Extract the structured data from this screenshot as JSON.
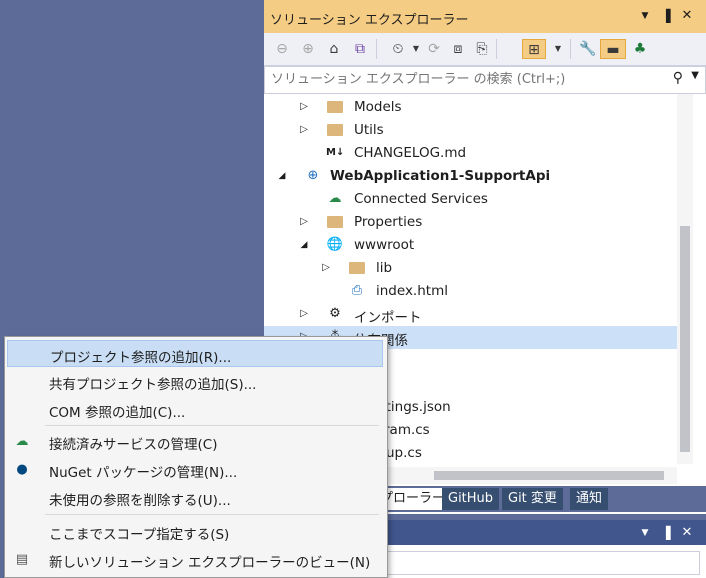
{
  "solution_explorer": {
    "title": "ソリューション エクスプローラー",
    "title_buttons": {
      "dropdown": "▼",
      "pin": "📌",
      "close": "✕"
    },
    "search_placeholder": "ソリューション エクスプローラー の検索 (Ctrl+;)",
    "tree": [
      {
        "label": "Models",
        "icon": "folder-icon",
        "arrow": "▷"
      },
      {
        "label": "Utils",
        "icon": "folder-icon",
        "arrow": "▷"
      },
      {
        "label": "CHANGELOG.md",
        "icon": "markdown-icon",
        "arrow": ""
      },
      {
        "label": "WebApplication1-SupportApi",
        "icon": "web-project-icon",
        "arrow": "◢"
      },
      {
        "label": "Connected Services",
        "icon": "connected-services-icon",
        "arrow": ""
      },
      {
        "label": "Properties",
        "icon": "properties-icon",
        "arrow": "▷"
      },
      {
        "label": "wwwroot",
        "icon": "globe-icon",
        "arrow": "◢"
      },
      {
        "label": "lib",
        "icon": "folder-icon",
        "arrow": "▷"
      },
      {
        "label": "index.html",
        "icon": "html-file-icon",
        "arrow": ""
      },
      {
        "label": "インポート",
        "icon": "imports-icon",
        "arrow": "▷"
      },
      {
        "label": "依存関係",
        "icon": "dependencies-icon",
        "arrow": "▷"
      },
      {
        "label": "ettings.json",
        "icon": "json-file-icon",
        "arrow": ""
      },
      {
        "label": "ram.cs",
        "icon": "cs-file-icon",
        "arrow": ""
      },
      {
        "label": "up.cs",
        "icon": "cs-file-icon",
        "arrow": ""
      }
    ]
  },
  "tabs": [
    {
      "label": "プローラー"
    },
    {
      "label": "GitHub"
    },
    {
      "label": "Git 変更"
    },
    {
      "label": "通知"
    }
  ],
  "context_menu": {
    "items": [
      {
        "label": "プロジェクト参照の追加(R)...",
        "icon": ""
      },
      {
        "label": "共有プロジェクト参照の追加(S)...",
        "icon": ""
      },
      {
        "label": "COM 参照の追加(C)...",
        "icon": ""
      },
      {
        "label": "接続済みサービスの管理(C)",
        "icon": "connected-services-icon"
      },
      {
        "label": "NuGet パッケージの管理(N)...",
        "icon": "nuget-icon"
      },
      {
        "label": "未使用の参照を削除する(U)...",
        "icon": ""
      },
      {
        "label": "ここまでスコープ指定する(S)",
        "icon": ""
      },
      {
        "label": "新しいソリューション エクスプローラーのビュー(N)",
        "icon": "new-view-icon"
      }
    ]
  },
  "colors": {
    "title_active": "#f5cc84",
    "menu_highlight": "#c9def5",
    "background": "#5d6b99",
    "tab_bar": "#364e6f"
  }
}
